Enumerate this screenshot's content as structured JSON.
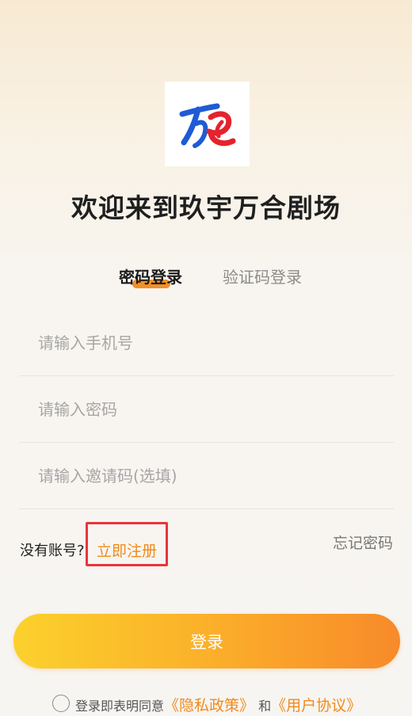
{
  "header": {
    "logo_icon": "jiuyu-wanhe-logo",
    "title": "欢迎来到玖宇万合剧场"
  },
  "tabs": [
    {
      "label": "密码登录",
      "active": true
    },
    {
      "label": "验证码登录",
      "active": false
    }
  ],
  "form": {
    "phone_placeholder": "请输入手机号",
    "password_placeholder": "请输入密码",
    "invite_placeholder": "请输入邀请码(选填)"
  },
  "register": {
    "prompt": "没有账号?",
    "link": "立即注册"
  },
  "forgot_password": "忘记密码",
  "login_button": "登录",
  "agreement": {
    "prefix": "登录即表明同意",
    "privacy": "《隐私政策》",
    "and": "和",
    "user_agreement": "《用户协议》"
  },
  "colors": {
    "accent": "#f08a1c",
    "highlight_box": "#e8353c",
    "button_start": "#fbd12c",
    "button_end": "#f88a2a"
  }
}
